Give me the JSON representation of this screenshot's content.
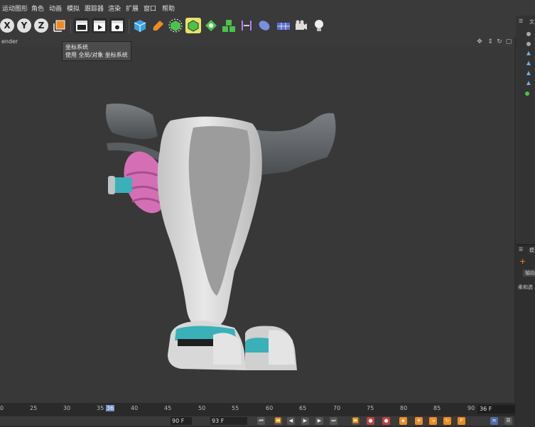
{
  "menu": [
    "运动图形",
    "角色",
    "动画",
    "模拟",
    "跟踪器",
    "渲染",
    "扩展",
    "窗口",
    "帮助"
  ],
  "toolbar": {
    "axis_x": "X",
    "axis_y": "Y",
    "axis_z": "Z"
  },
  "tooltip": {
    "title": "坐标系统",
    "desc": "使用 全局/对象 坐标系统"
  },
  "viewport": {
    "title": "ender"
  },
  "right_panel": {
    "top_label": "文",
    "section_label": "柔和选",
    "btn_label": "轴向",
    "mode_label": "模"
  },
  "timeline": {
    "ticks": [
      "0",
      "25",
      "30",
      "35",
      "36",
      "40",
      "45",
      "50",
      "55",
      "60",
      "65",
      "70",
      "75",
      "80",
      "85",
      "90"
    ],
    "current_frame": "36 F",
    "start_field": "90 F",
    "end_field": "93 F"
  },
  "colors": {
    "accent_orange": "#f08a1e",
    "accent_teal": "#3ab0b8",
    "accent_pink": "#d46fb6",
    "model_white": "#d8d8d8",
    "model_dark": "#5e6266"
  }
}
